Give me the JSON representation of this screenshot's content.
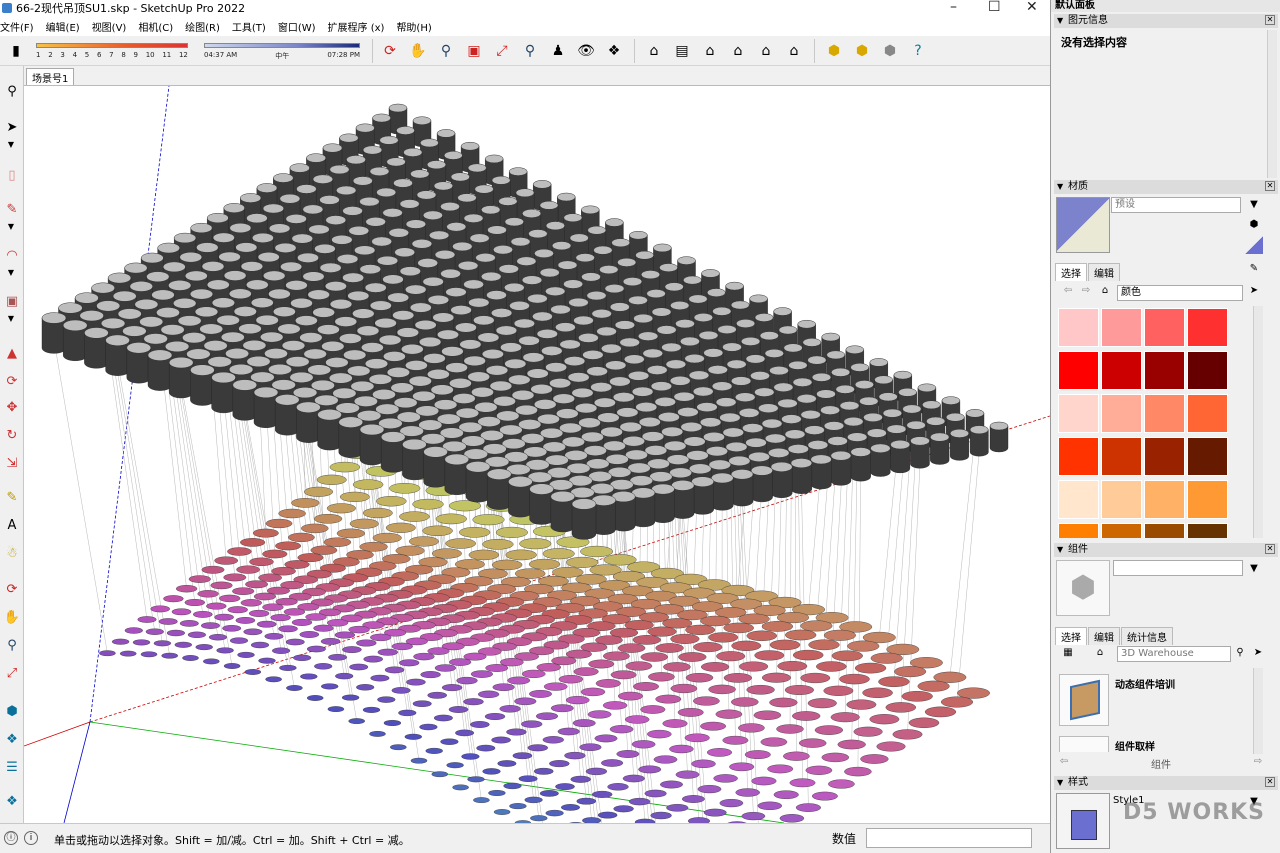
{
  "window": {
    "title": "66-2现代吊顶SU1.skp - SketchUp Pro 2022"
  },
  "menu": [
    "文件(F)",
    "编辑(E)",
    "视图(V)",
    "相机(C)",
    "绘图(R)",
    "工具(T)",
    "窗口(W)",
    "扩展程序 (x)",
    "帮助(H)"
  ],
  "toolbar": {
    "month_ticks": [
      "1",
      "2",
      "3",
      "4",
      "5",
      "6",
      "7",
      "8",
      "9",
      "10",
      "11",
      "12"
    ],
    "time_start": "04:37 AM",
    "time_mid": "中午",
    "time_end": "07:28 PM"
  },
  "scene": {
    "tab_label": "场景号1"
  },
  "status": {
    "message": "单击或拖动以选择对象。Shift = 加/减。Ctrl = 加。Shift + Ctrl = 减。",
    "value_label": "数值"
  },
  "tray": {
    "title": "默认面板",
    "entity_info": {
      "header": "图元信息",
      "content": "没有选择内容"
    },
    "materials": {
      "header": "材质",
      "name_placeholder": "预设",
      "tab_select": "选择",
      "tab_edit": "编辑",
      "library": "颜色",
      "swatches": [
        "#ffc7c7",
        "#ff9a9a",
        "#ff6060",
        "#ff3030",
        "#ff0000",
        "#cc0000",
        "#990000",
        "#660000",
        "#ffd5cc",
        "#ffac99",
        "#ff8866",
        "#ff6633",
        "#ff3300",
        "#cc3300",
        "#992200",
        "#661a00",
        "#ffe6cc",
        "#ffcc99",
        "#ffb266",
        "#ff9933",
        "#ff8000",
        "#cc6600",
        "#994c00",
        "#663300"
      ]
    },
    "components": {
      "header": "组件",
      "tab_select": "选择",
      "tab_edit": "编辑",
      "tab_stats": "统计信息",
      "search_placeholder": "3D Warehouse",
      "items": [
        "动态组件培训",
        "组件取样"
      ],
      "footer": "组件"
    },
    "styles": {
      "header": "样式",
      "style_name": "Style1",
      "watermark": "D5 WORKS"
    }
  },
  "colors": {
    "accent_red": "#e23a2e",
    "axis_red": "#cc0000",
    "axis_green": "#00aa00",
    "axis_blue": "#0000cc",
    "cylinder_dark": "#3a3a3a",
    "cylinder_top": "#bdbdbd"
  }
}
